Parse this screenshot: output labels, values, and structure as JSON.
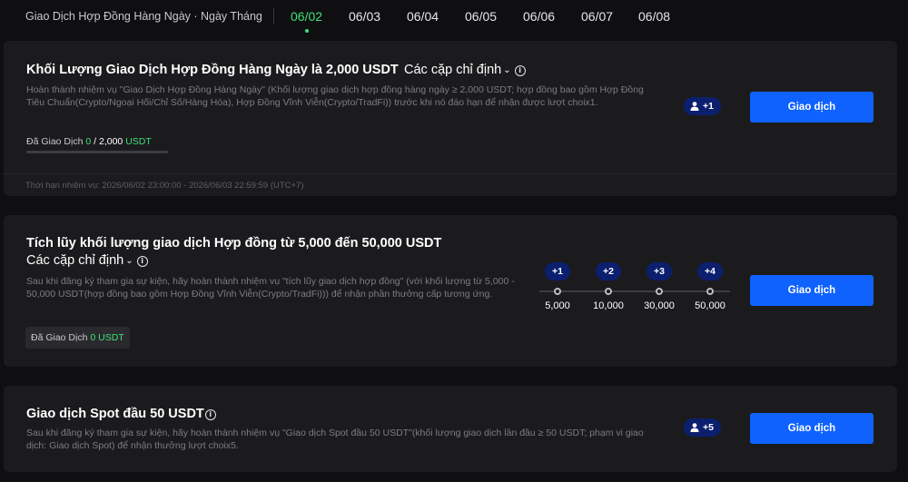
{
  "header": {
    "title": "Giao Dịch Hợp Đồng Hàng Ngày · Ngày Tháng",
    "dates": [
      "06/02",
      "06/03",
      "06/04",
      "06/05",
      "06/06",
      "06/07",
      "06/08"
    ],
    "active_date": "06/02"
  },
  "task1": {
    "title": "Khối Lượng Giao Dịch Hợp Đồng Hàng Ngày là 2,000 USDT",
    "pairs_label": "Các cặp chỉ định",
    "description": "Hoàn thành nhiệm vụ \"Giao Dịch Hợp Đồng Hàng Ngày\" (Khối lượng giao dịch hợp đồng hàng ngày ≥ 2,000 USDT; hợp đồng bao gồm Hợp Đồng Tiêu Chuẩn(Crypto/Ngoại Hối/Chỉ Số/Hàng Hóa), Hợp Đồng Vĩnh Viễn(Crypto/TradFi)) trước khi nó đáo hạn để nhận được lượt choix1.",
    "progress_prefix": "Đã Giao Dịch",
    "progress_current": "0",
    "progress_target": "/ 2,000",
    "progress_unit": "USDT",
    "progress_fraction": 0,
    "reward": "+1",
    "button_label": "Giao dịch",
    "deadline": "Thời hạn nhiệm vụ: 2026/06/02 23:00:00 - 2026/06/03 22:59:59 (UTC+7)"
  },
  "task2": {
    "title": "Tích lũy khối lượng giao dịch Hợp đồng từ 5,000 đến 50,000 USDT",
    "pairs_label": "Các cặp chỉ định",
    "description": "Sau khi đăng ký tham gia sự kiện, hãy hoàn thành nhiệm vụ \"tích lũy giao dịch hợp đồng\" (với khối lượng từ 5,000 - 50,000 USDT(hợp đồng bao gồm Hợp Đồng Vĩnh Viễn(Crypto/TradFi))) để nhận phần thưởng cấp tương ứng.",
    "traded_prefix": "Đã Giao Dịch",
    "traded_value": "0 USDT",
    "tiers": [
      {
        "reward": "+1",
        "amount": "5,000"
      },
      {
        "reward": "+2",
        "amount": "10,000"
      },
      {
        "reward": "+3",
        "amount": "30,000"
      },
      {
        "reward": "+4",
        "amount": "50,000"
      }
    ],
    "button_label": "Giao dịch"
  },
  "task3": {
    "title": "Giao dịch Spot đầu 50 USDT",
    "description": "Sau khi đăng ký tham gia sự kiện, hãy hoàn thành nhiệm vụ \"Giao dịch Spot đầu 50 USDT\"(khối lượng giao dịch lần đầu ≥ 50 USDT; phạm vi giao dịch: Giao dịch Spot) để nhận thưởng lượt choix5.",
    "reward": "+5",
    "button_label": "Giao dịch"
  },
  "colors": {
    "background": "#0f0f11",
    "card": "#1b1b1e",
    "accent_green": "#3ee07a",
    "button_blue": "#0f62fe",
    "badge_navy": "#0b1f6e"
  },
  "icons": {
    "chevron": "chevron-down-icon",
    "info": "info-icon",
    "user": "user-icon"
  }
}
